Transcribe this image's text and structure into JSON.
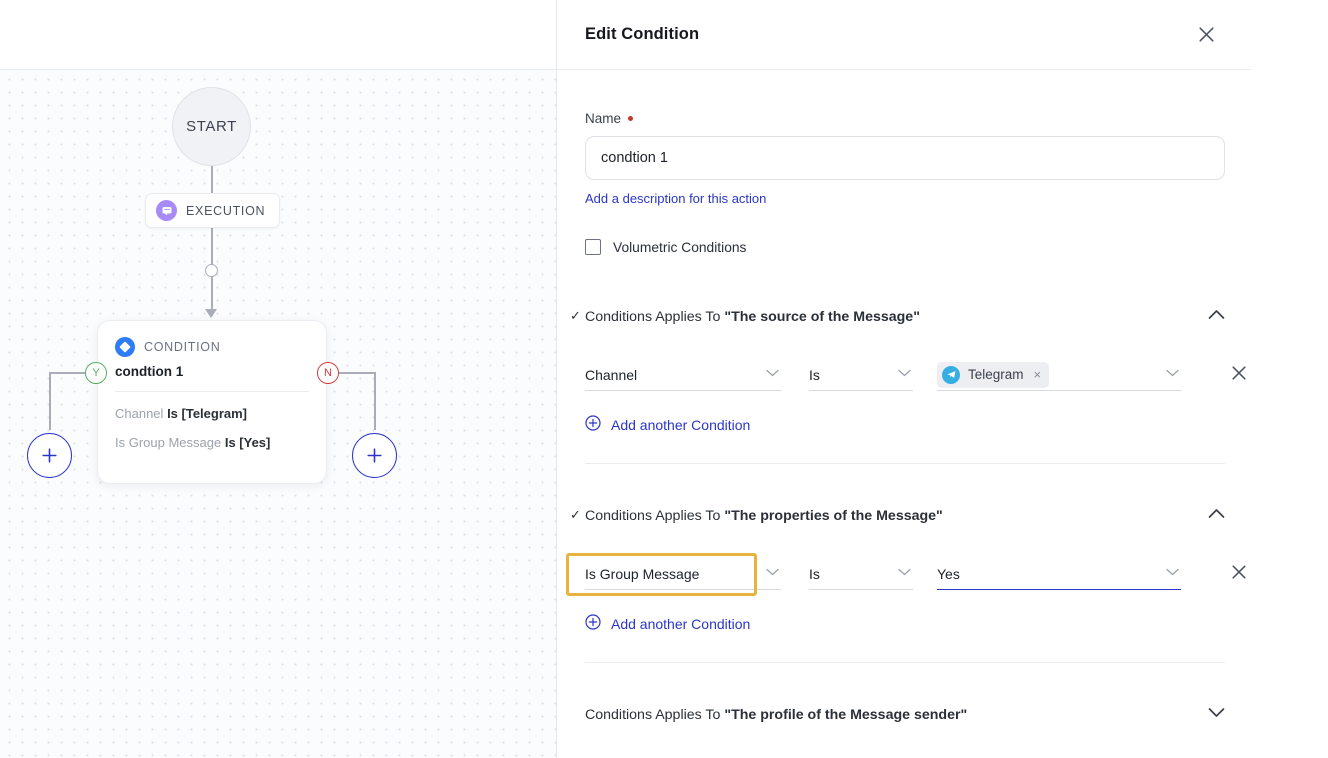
{
  "canvas": {
    "start_node": {
      "label": "START"
    },
    "execution_badge": {
      "label": "EXECUTION",
      "icon": "chat-bubble-icon"
    },
    "condition_node": {
      "kind_label": "CONDITION",
      "title": "condtion 1",
      "rules": [
        {
          "field": "Channel",
          "op_value": "Is [Telegram]"
        },
        {
          "field": "Is Group Message",
          "op_value": "Is [Yes]"
        }
      ],
      "branch_yes_label": "Y",
      "branch_no_label": "N",
      "add_button_label": "+"
    },
    "colors": {
      "yes_badge": "#4fae5a",
      "no_badge": "#cf3b3b",
      "condition_icon": "#2f7df6",
      "execution_icon": "#a78bfa",
      "plus_button": "#2b35c8"
    }
  },
  "panel": {
    "title": "Edit Condition",
    "close_icon": "close-icon",
    "name": {
      "label": "Name",
      "required": true,
      "value": "condtion 1",
      "placeholder": "Name"
    },
    "description_link": "Add a description for this action",
    "volumetric": {
      "label": "Volumetric Conditions",
      "checked": false
    },
    "sections": [
      {
        "prefix": "Conditions Applies To ",
        "target": "\"The source of the Message\"",
        "expanded": true,
        "caret": "chevron-up-icon",
        "checked": true,
        "rows": [
          {
            "field": "Channel",
            "operator": "Is",
            "value_type": "chip",
            "chip": {
              "label": "Telegram",
              "icon": "telegram-icon",
              "remove": "×"
            },
            "focused": false
          }
        ],
        "add_label": "Add another Condition"
      },
      {
        "prefix": "Conditions Applies To ",
        "target": "\"The properties of the Message\"",
        "expanded": true,
        "caret": "chevron-up-icon",
        "checked": true,
        "rows": [
          {
            "field": "Is Group Message",
            "operator": "Is",
            "value_type": "text",
            "value": "Yes",
            "focused": true
          }
        ],
        "add_label": "Add another Condition"
      },
      {
        "prefix": "Conditions Applies To ",
        "target": "\"The profile of the Message sender\"",
        "expanded": false,
        "caret": "chevron-down-icon",
        "checked": false,
        "rows": [],
        "add_label": ""
      }
    ],
    "highlight_color": "#e8b33d",
    "accent_color": "#2b35c8"
  }
}
